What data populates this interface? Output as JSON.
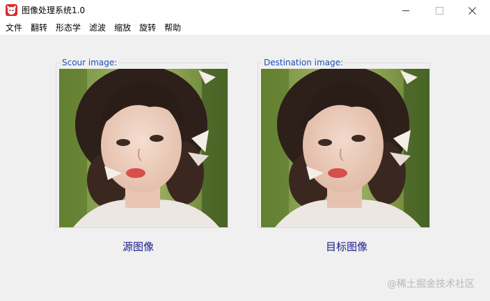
{
  "window": {
    "title": "图像处理系统1.0",
    "icon": "app-cat-icon"
  },
  "menubar": {
    "items": [
      {
        "label": "文件"
      },
      {
        "label": "翻转"
      },
      {
        "label": "形态学"
      },
      {
        "label": "滤波"
      },
      {
        "label": "缩放"
      },
      {
        "label": "旋转"
      },
      {
        "label": "帮助"
      }
    ]
  },
  "panels": {
    "source": {
      "group_label": "Scour image:",
      "caption": "源图像"
    },
    "destination": {
      "group_label": "Destination image:",
      "caption": "目标图像"
    }
  },
  "watermark": "@稀土掘金技术社区",
  "colors": {
    "group_label": "#1b4fb3",
    "caption": "#1c1c8f",
    "window_bg": "#f0f0f0"
  }
}
